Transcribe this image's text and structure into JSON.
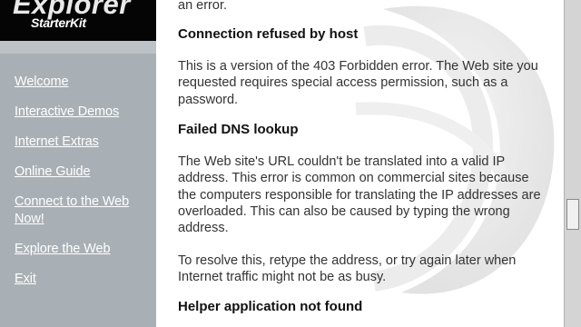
{
  "logo": {
    "title": "Explorer",
    "subtitle": "StarterKit"
  },
  "sidebar": {
    "items": [
      {
        "label": "Welcome"
      },
      {
        "label": "Interactive Demos"
      },
      {
        "label": "Internet Extras"
      },
      {
        "label": "Online Guide"
      },
      {
        "label": "Connect to the Web",
        "label2": "Now!"
      },
      {
        "label": "Explore the Web"
      },
      {
        "label": "Exit"
      }
    ]
  },
  "content": {
    "intro_tail": "an error.",
    "sections": [
      {
        "heading": "Connection refused by host",
        "paragraphs": [
          "This is a version of the 403 Forbidden error. The Web site you requested requires special access permission, such as a password."
        ]
      },
      {
        "heading": "Failed DNS lookup",
        "paragraphs": [
          "The Web site's URL couldn't be translated into a valid IP address. This error is common on commercial sites because the computers responsible for translating the IP addresses are overloaded. This can also be caused by typing the wrong address.",
          "To resolve this, retype the address, or try again later when Internet traffic might not be as busy."
        ]
      },
      {
        "heading": "Helper application not found",
        "paragraphs": []
      }
    ]
  },
  "colors": {
    "sidebar_bg": "#a9b0b5",
    "logo_bg": "#050505",
    "link": "#ffffff",
    "text": "#333333"
  }
}
